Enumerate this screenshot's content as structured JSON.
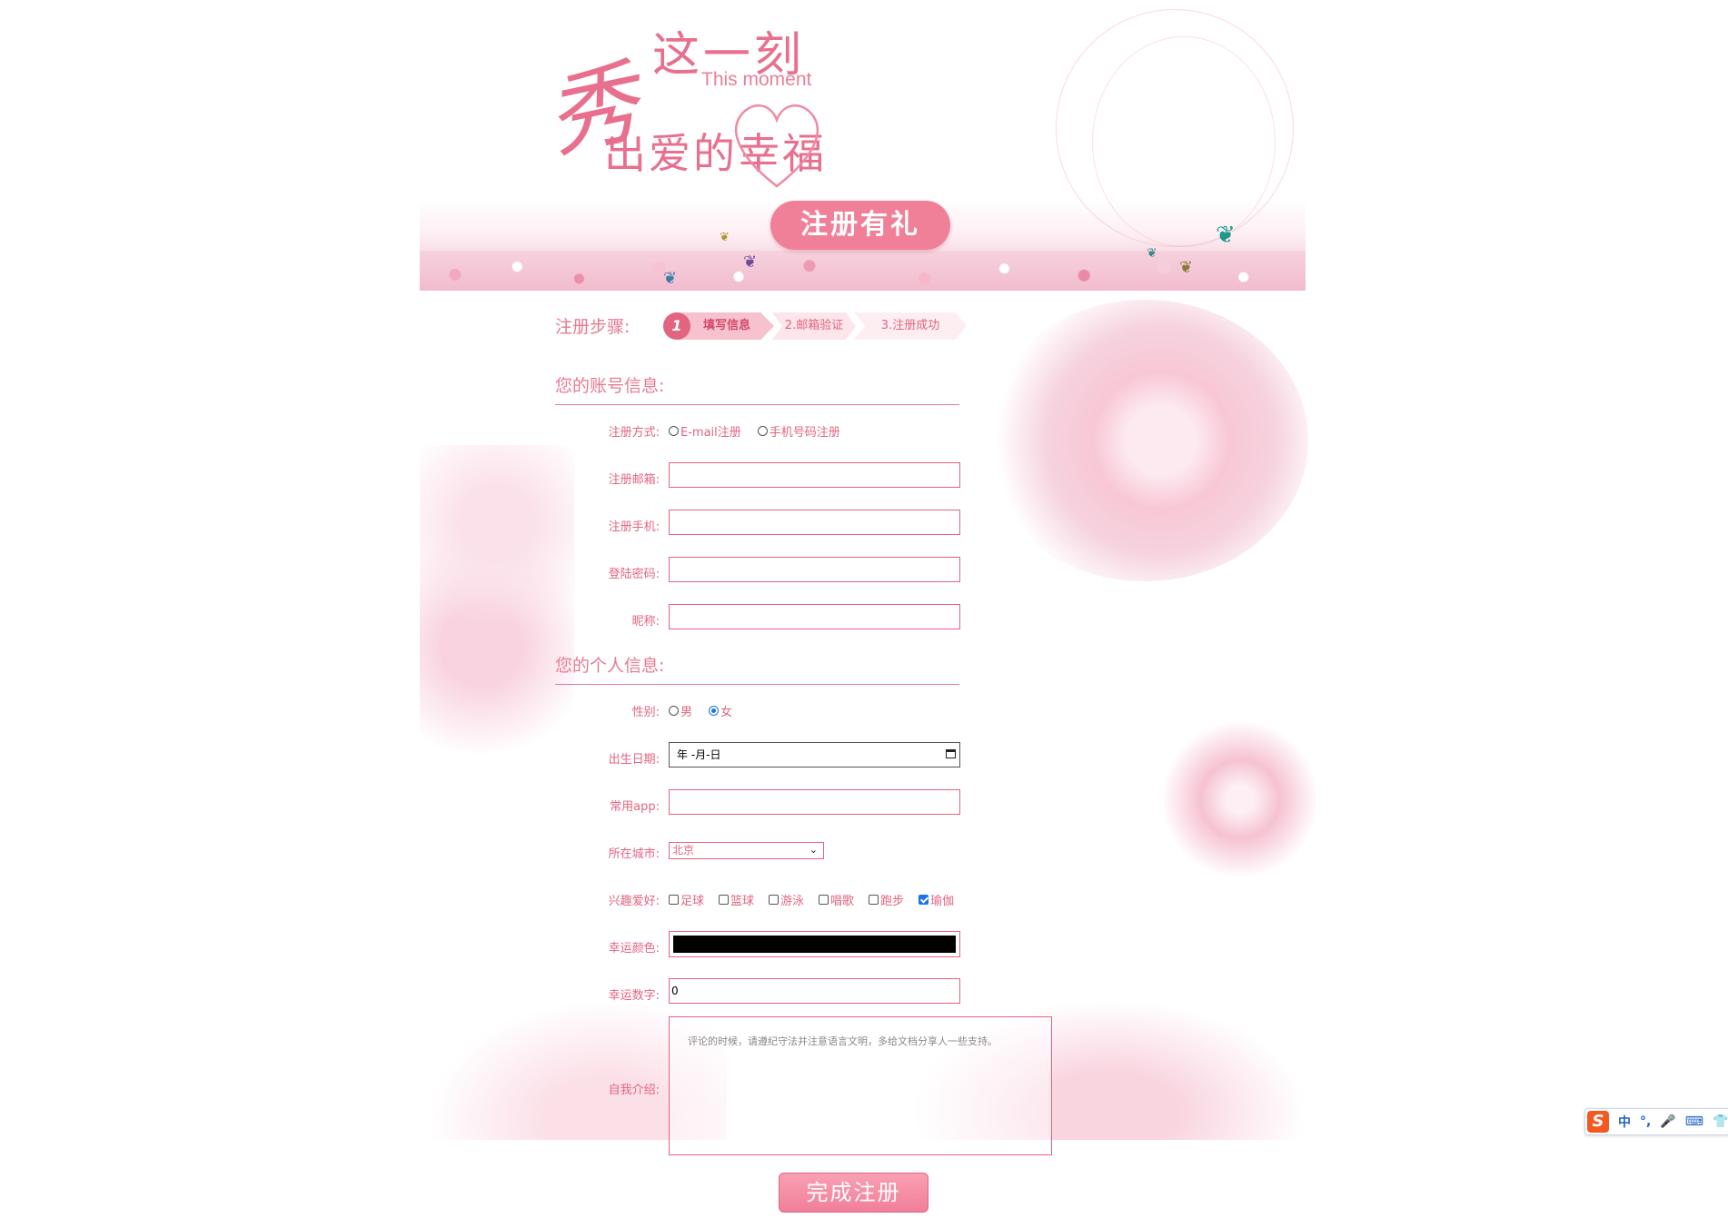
{
  "banner": {
    "title_xiu": "秀",
    "title_moment_cn": "这一刻",
    "title_moment_en": "This moment",
    "title_love": "出爱的幸福",
    "gift_button": "注册有礼"
  },
  "steps": {
    "label": "注册步骤:",
    "items": [
      {
        "num": "1",
        "label": "填写信息",
        "active": true
      },
      {
        "label": "2.邮箱验证",
        "active": false
      },
      {
        "label": "3.注册成功",
        "active": false
      }
    ]
  },
  "account_section": {
    "title": "您的账号信息:",
    "reg_method_label": "注册方式:",
    "reg_method_options": [
      "E-mail注册",
      "手机号码注册"
    ],
    "email_label": "注册邮箱:",
    "email_value": "",
    "phone_label": "注册手机:",
    "phone_value": "",
    "password_label": "登陆密码:",
    "password_value": "",
    "nickname_label": "昵称:",
    "nickname_value": ""
  },
  "personal_section": {
    "title": "您的个人信息:",
    "gender_label": "性别:",
    "gender_options": [
      {
        "label": "男",
        "checked": false
      },
      {
        "label": "女",
        "checked": true
      }
    ],
    "birthday_label": "出生日期:",
    "birthday_placeholder": "年 -月-日",
    "app_label": "常用app:",
    "app_value": "",
    "city_label": "所在城市:",
    "city_value": "北京",
    "hobby_label": "兴趣爱好:",
    "hobbies": [
      {
        "label": "足球",
        "checked": false
      },
      {
        "label": "篮球",
        "checked": false
      },
      {
        "label": "游泳",
        "checked": false
      },
      {
        "label": "唱歌",
        "checked": false
      },
      {
        "label": "跑步",
        "checked": false
      },
      {
        "label": "瑜伽",
        "checked": true
      }
    ],
    "color_label": "幸运颜色:",
    "color_value": "#000000",
    "number_label": "幸运数字:",
    "number_value": "0",
    "intro_label": "自我介绍:",
    "intro_placeholder": "评论的时候，请遵纪守法并注意语言文明，多给文档分享人一些支持。"
  },
  "submit_label": "完成注册",
  "ime": {
    "logo": "S",
    "items": [
      "中",
      "°,",
      "🎤",
      "⌨",
      "👕"
    ]
  },
  "colors": {
    "accent": "#e3647f",
    "accent_light": "#f07f98"
  }
}
